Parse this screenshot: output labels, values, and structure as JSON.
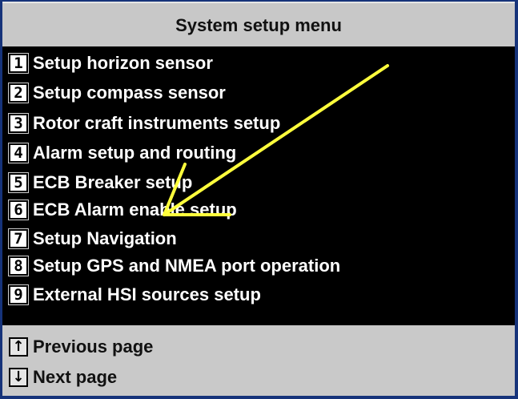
{
  "title": "System setup menu",
  "menu_items": [
    {
      "key": "1",
      "label": "Setup horizon sensor"
    },
    {
      "key": "2",
      "label": "Setup compass sensor"
    },
    {
      "key": "3",
      "label": "Rotor craft instruments setup"
    },
    {
      "key": "4",
      "label": "Alarm setup and routing"
    },
    {
      "key": "5",
      "label": "ECB Breaker setup"
    },
    {
      "key": "6",
      "label": "ECB Alarm enable setup"
    },
    {
      "key": "7",
      "label": "Setup Navigation"
    },
    {
      "key": "8",
      "label": "Setup GPS and NMEA port operation"
    },
    {
      "key": "9",
      "label": "External HSI sources setup"
    }
  ],
  "footer": {
    "prev": {
      "key": "↑",
      "label": "Previous page"
    },
    "next": {
      "key": "↓",
      "label": "Next page"
    }
  },
  "colors": {
    "frame_border": "#16337a",
    "title_bg": "#c8c8c8",
    "menu_bg": "#000000",
    "menu_text": "#ffffff",
    "annotation_arrow": "#ffff3c"
  },
  "icons": {
    "annotation": "arrow-annotation-icon"
  }
}
